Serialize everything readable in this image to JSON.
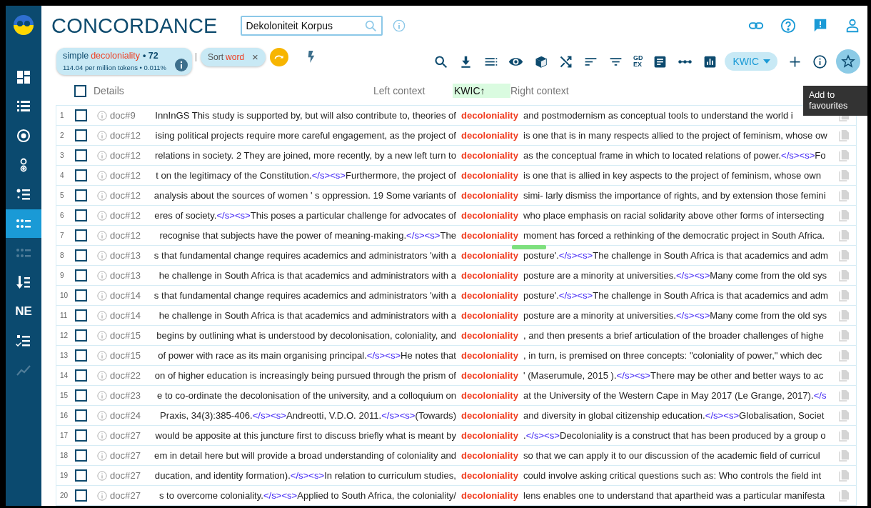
{
  "sidebar": {
    "items": [
      {
        "kind": "icon",
        "selected": false,
        "disabled": false
      },
      {
        "kind": "icon",
        "selected": false,
        "disabled": false
      },
      {
        "kind": "icon",
        "selected": false,
        "disabled": false
      },
      {
        "kind": "icon",
        "selected": false,
        "disabled": false
      },
      {
        "kind": "icon",
        "selected": false,
        "disabled": false
      },
      {
        "kind": "icon",
        "selected": true,
        "disabled": false
      },
      {
        "kind": "icon",
        "selected": false,
        "disabled": true
      },
      {
        "kind": "icon",
        "selected": false,
        "disabled": false
      },
      {
        "kind": "text",
        "label": "NE",
        "selected": false,
        "disabled": false
      },
      {
        "kind": "icon",
        "selected": false,
        "disabled": false
      },
      {
        "kind": "icon",
        "selected": false,
        "disabled": true
      }
    ]
  },
  "header": {
    "title": "CONCORDANCE",
    "corpus": {
      "value": "Dekoloniteit Korpus"
    }
  },
  "query": {
    "type": "simple",
    "term": "decoloniality",
    "count": "• 72",
    "stats": "114.04 per million tokens • 0.011%"
  },
  "sort_chip": {
    "label": "Sort",
    "value": "word",
    "close": "×"
  },
  "toolbar": {
    "gdex": [
      "GD",
      "EX"
    ],
    "view_menu": {
      "label": "KWIC"
    },
    "favourite": {
      "highlighted": true,
      "tooltip": "Add to favourites"
    }
  },
  "table": {
    "columns": [
      {
        "label": "Details",
        "sorted": false
      },
      {
        "label": "Left context",
        "sorted": false
      },
      {
        "label": "KWIC",
        "sorted": true,
        "arrow": "↑"
      },
      {
        "label": "Right context",
        "sorted": false
      }
    ],
    "header_checked": false,
    "rows": [
      {
        "line": "1",
        "checked": false,
        "doc": "doc#9",
        "left": [
          {
            "kind": "text",
            "text": "InnInGS This study is supported by, but will also contribute to, theories of"
          }
        ],
        "kwic": "decoloniality",
        "right": [
          {
            "kind": "text",
            "text": "and postmodernism as conceptual tools to understand the world i"
          }
        ],
        "marked": false
      },
      {
        "line": "2",
        "checked": false,
        "doc": "doc#12",
        "left": [
          {
            "kind": "text",
            "text": "ising political projects require more careful engagement, as the project of"
          }
        ],
        "kwic": "decoloniality",
        "right": [
          {
            "kind": "text",
            "text": "is one that is in many respects allied to the project of feminism, whose ow"
          }
        ],
        "marked": false
      },
      {
        "line": "3",
        "checked": false,
        "doc": "doc#12",
        "left": [
          {
            "kind": "text",
            "text": "relations in society. 2 They are joined, more recently, by a new left turn to"
          }
        ],
        "kwic": "decoloniality",
        "right": [
          {
            "kind": "text",
            "text": "as the conceptual frame in which to located relations of power."
          },
          {
            "kind": "tag",
            "text": "</s><s>"
          },
          {
            "kind": "text",
            "text": "Fo"
          }
        ],
        "marked": false
      },
      {
        "line": "4",
        "checked": false,
        "doc": "doc#12",
        "left": [
          {
            "kind": "text",
            "text": "t on the legitimacy of the Constitution."
          },
          {
            "kind": "tag",
            "text": "</s><s>"
          },
          {
            "kind": "text",
            "text": "Furthermore, the project of"
          }
        ],
        "kwic": "decoloniality",
        "right": [
          {
            "kind": "text",
            "text": "is one that is allied in key aspects to the project of feminism, whose own"
          }
        ],
        "marked": false
      },
      {
        "line": "5",
        "checked": false,
        "doc": "doc#12",
        "left": [
          {
            "kind": "text",
            "text": "analysis about the sources of women ' s oppression. 19 Some variants of"
          }
        ],
        "kwic": "decoloniality",
        "right": [
          {
            "kind": "text",
            "text": "simi- larly dismiss the importance of rights, and by extension those femini"
          }
        ],
        "marked": false
      },
      {
        "line": "6",
        "checked": false,
        "doc": "doc#12",
        "left": [
          {
            "kind": "text",
            "text": "eres of society."
          },
          {
            "kind": "tag",
            "text": "</s><s>"
          },
          {
            "kind": "text",
            "text": "This poses a particular challenge for advocates of"
          }
        ],
        "kwic": "decoloniality",
        "right": [
          {
            "kind": "text",
            "text": "who place emphasis on racial solidarity above other forms of intersecting"
          }
        ],
        "marked": false
      },
      {
        "line": "7",
        "checked": false,
        "doc": "doc#12",
        "left": [
          {
            "kind": "text",
            "text": "recognise that subjects have the power of meaning-making."
          },
          {
            "kind": "tag",
            "text": "</s><s>"
          },
          {
            "kind": "text",
            "text": "The"
          }
        ],
        "kwic": "decoloniality",
        "right": [
          {
            "kind": "text",
            "text": "moment has forced a rethinking of the democratic project in South Africa."
          }
        ],
        "marked": true
      },
      {
        "line": "8",
        "checked": false,
        "doc": "doc#13",
        "left": [
          {
            "kind": "text",
            "text": "s that fundamental change requires academics and administrators 'with a"
          }
        ],
        "kwic": "decoloniality",
        "right": [
          {
            "kind": "text",
            "text": "posture'."
          },
          {
            "kind": "tag",
            "text": "</s><s>"
          },
          {
            "kind": "text",
            "text": "The challenge in South Africa is that academics and adm"
          }
        ],
        "marked": false
      },
      {
        "line": "9",
        "checked": false,
        "doc": "doc#13",
        "left": [
          {
            "kind": "text",
            "text": "he challenge in South Africa is that academics and administrators with a"
          }
        ],
        "kwic": "decoloniality",
        "right": [
          {
            "kind": "text",
            "text": "posture are a minority at universities."
          },
          {
            "kind": "tag",
            "text": "</s><s>"
          },
          {
            "kind": "text",
            "text": "Many come from the old sys"
          }
        ],
        "marked": false
      },
      {
        "line": "10",
        "checked": false,
        "doc": "doc#14",
        "left": [
          {
            "kind": "text",
            "text": "s that fundamental change requires academics and administrators 'with a"
          }
        ],
        "kwic": "decoloniality",
        "right": [
          {
            "kind": "text",
            "text": "posture'."
          },
          {
            "kind": "tag",
            "text": "</s><s>"
          },
          {
            "kind": "text",
            "text": "The challenge in South Africa is that academics and adm"
          }
        ],
        "marked": false
      },
      {
        "line": "11",
        "checked": false,
        "doc": "doc#14",
        "left": [
          {
            "kind": "text",
            "text": "he challenge in South Africa is that academics and administrators with a"
          }
        ],
        "kwic": "decoloniality",
        "right": [
          {
            "kind": "text",
            "text": "posture are a minority at universities."
          },
          {
            "kind": "tag",
            "text": "</s><s>"
          },
          {
            "kind": "text",
            "text": "Many come from the old sys"
          }
        ],
        "marked": false
      },
      {
        "line": "12",
        "checked": false,
        "doc": "doc#15",
        "left": [
          {
            "kind": "text",
            "text": "begins by outlining what is understood by decolonisation, coloniality, and"
          }
        ],
        "kwic": "decoloniality",
        "right": [
          {
            "kind": "text",
            "text": ", and then presents a brief articulation of the broader challenges of highe"
          }
        ],
        "marked": false
      },
      {
        "line": "13",
        "checked": false,
        "doc": "doc#15",
        "left": [
          {
            "kind": "text",
            "text": "of power with race as its main organising principal."
          },
          {
            "kind": "tag",
            "text": "</s><s>"
          },
          {
            "kind": "text",
            "text": "He notes that"
          }
        ],
        "kwic": "decoloniality",
        "right": [
          {
            "kind": "text",
            "text": ", in turn, is premised on three concepts: \"coloniality of power,\" which dec"
          }
        ],
        "marked": false
      },
      {
        "line": "14",
        "checked": false,
        "doc": "doc#22",
        "left": [
          {
            "kind": "text",
            "text": "on of higher education is increasingly being pursued through the prism of"
          }
        ],
        "kwic": "decoloniality",
        "right": [
          {
            "kind": "text",
            "text": "' (Maserumule, 2015 )."
          },
          {
            "kind": "tag",
            "text": "</s><s>"
          },
          {
            "kind": "text",
            "text": "There may be other and better ways to ac"
          }
        ],
        "marked": false
      },
      {
        "line": "15",
        "checked": false,
        "doc": "doc#23",
        "left": [
          {
            "kind": "text",
            "text": "e to co-ordinate the decolonisation of the university, and a colloquium on"
          }
        ],
        "kwic": "decoloniality",
        "right": [
          {
            "kind": "text",
            "text": "at the University of the Western Cape in May 2017 (Le Grange, 2017)."
          },
          {
            "kind": "tag",
            "text": "</s"
          }
        ],
        "marked": false
      },
      {
        "line": "16",
        "checked": false,
        "doc": "doc#24",
        "left": [
          {
            "kind": "text",
            "text": "Praxis, 34(3):385-406."
          },
          {
            "kind": "tag",
            "text": "</s><s>"
          },
          {
            "kind": "text",
            "text": "Andreotti, V.D.O. 2011."
          },
          {
            "kind": "tag",
            "text": "</s><s>"
          },
          {
            "kind": "text",
            "text": "(Towards)"
          }
        ],
        "kwic": "decoloniality",
        "right": [
          {
            "kind": "text",
            "text": "and diversity in global citizenship education."
          },
          {
            "kind": "tag",
            "text": "</s><s>"
          },
          {
            "kind": "text",
            "text": "Globalisation, Societ"
          }
        ],
        "marked": false
      },
      {
        "line": "17",
        "checked": false,
        "doc": "doc#27",
        "left": [
          {
            "kind": "text",
            "text": "would be apposite at this juncture first to discuss briefly what is meant by"
          }
        ],
        "kwic": "decoloniality",
        "right": [
          {
            "kind": "text",
            "text": "."
          },
          {
            "kind": "tag",
            "text": "</s><s>"
          },
          {
            "kind": "text",
            "text": "Decoloniality is a construct that has been produced by a group o"
          }
        ],
        "marked": false
      },
      {
        "line": "18",
        "checked": false,
        "doc": "doc#27",
        "left": [
          {
            "kind": "text",
            "text": "em in detail here but will provide a broad understanding of coloniality and"
          }
        ],
        "kwic": "decoloniality",
        "right": [
          {
            "kind": "text",
            "text": "so that we can apply it to our discussion of the academic field of curricul"
          }
        ],
        "marked": false
      },
      {
        "line": "19",
        "checked": false,
        "doc": "doc#27",
        "left": [
          {
            "kind": "text",
            "text": "ducation, and identity formation)."
          },
          {
            "kind": "tag",
            "text": "</s><s>"
          },
          {
            "kind": "text",
            "text": "In relation to curriculum studies,"
          }
        ],
        "kwic": "decoloniality",
        "right": [
          {
            "kind": "text",
            "text": "could involve asking critical questions such as: Who controls the field int"
          }
        ],
        "marked": false
      },
      {
        "line": "20",
        "checked": false,
        "doc": "doc#27",
        "left": [
          {
            "kind": "text",
            "text": "s to overcome coloniality."
          },
          {
            "kind": "tag",
            "text": "</s><s>"
          },
          {
            "kind": "text",
            "text": "Applied to South Africa, the coloniality/"
          }
        ],
        "kwic": "decoloniality",
        "right": [
          {
            "kind": "text",
            "text": "lens enables one to understand that apartheid was a particular manifesta"
          }
        ],
        "marked": false
      }
    ]
  }
}
